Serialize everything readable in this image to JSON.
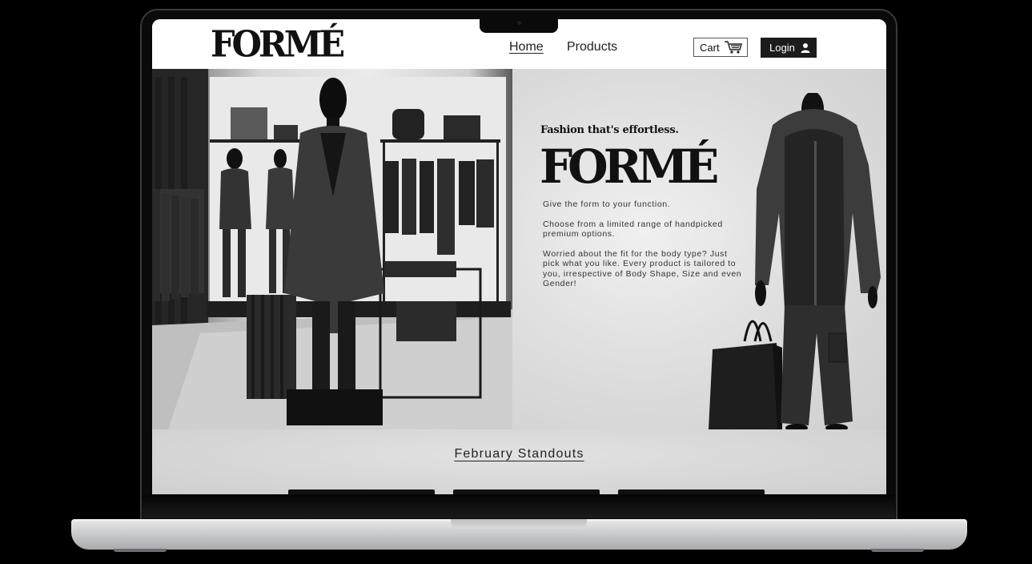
{
  "header": {
    "logo": "FORMÉ",
    "nav": {
      "home": "Home",
      "products": "Products"
    },
    "cart_label": "Cart",
    "login_label": "Login"
  },
  "hero": {
    "tagline": "Fashion that's effortless.",
    "logo": "FORMÉ",
    "copy": [
      "Give the form to your function.",
      "Choose from a limited range of handpicked premium options.",
      "Worried about the fit for the body type? Just pick what you like. Every product is tailored to you, irrespective of Body Shape, Size and even Gender!"
    ]
  },
  "standouts": {
    "title": "February Standouts"
  },
  "icons": {
    "cart": "cart-icon",
    "user": "user-icon",
    "showroom": "showroom-photo",
    "model": "hoodie-model-photo"
  }
}
